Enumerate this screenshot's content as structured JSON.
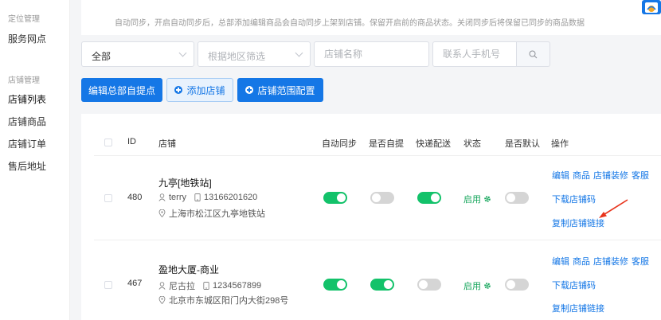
{
  "sidebar": {
    "group1": "定位管理",
    "service": "服务网点",
    "group2": "店铺管理",
    "items": [
      "店铺列表",
      "店铺商品",
      "店铺订单",
      "售后地址"
    ]
  },
  "notice": "自动同步，开启自动同步后，总部添加编辑商品会自动同步上架到店铺。保留开启前的商品状态。关闭同步后将保留已同步的商品数据",
  "filters": {
    "type_value": "全部",
    "region_placeholder": "根据地区筛选",
    "store_placeholder": "店铺名称",
    "phone_placeholder": "联系人手机号"
  },
  "buttons": {
    "edit_pickup": "编辑总部自提点",
    "add_store": "添加店铺",
    "store_range": "店铺范围配置"
  },
  "table": {
    "headers": {
      "id": "ID",
      "store": "店铺",
      "auto_sync": "自动同步",
      "self_pickup": "是否自提",
      "express": "快递配送",
      "status": "状态",
      "default": "是否默认",
      "actions": "操作"
    },
    "rows": [
      {
        "id": "480",
        "name": "九亭[地铁站]",
        "contact": "terry",
        "phone": "13166201620",
        "address": "上海市松江区九亭地铁站",
        "auto_sync": true,
        "self_pickup": false,
        "express": true,
        "status": "启用",
        "is_default": false,
        "actions": [
          "编辑",
          "商品",
          "店铺装修",
          "客服"
        ],
        "download_code": "下载店铺码",
        "copy_link": "复制店铺链接"
      },
      {
        "id": "467",
        "name": "盈地大厦-商业",
        "contact": "尼古拉",
        "phone": "1234567899",
        "address": "北京市东城区阳门内大街298号",
        "auto_sync": true,
        "self_pickup": true,
        "express": false,
        "status": "启用",
        "is_default": false,
        "actions": [
          "编辑",
          "商品",
          "店铺装修",
          "客服"
        ],
        "download_code": "下载店铺码",
        "copy_link": "复制店铺链接"
      }
    ]
  },
  "colors": {
    "primary": "#1577e6",
    "toggle_on": "#13c26a",
    "toggle_off": "#d5d5d5",
    "arrow": "#e8341c"
  }
}
